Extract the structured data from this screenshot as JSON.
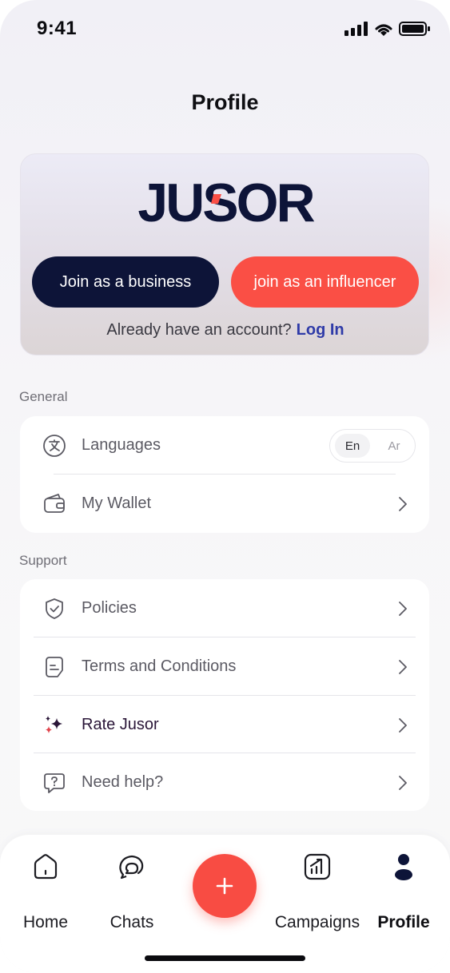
{
  "status_bar": {
    "time": "9:41"
  },
  "page": {
    "title": "Profile"
  },
  "hero": {
    "logo_text": "JUSOR",
    "business_button": "Join as a business",
    "influencer_button": "join as an influencer",
    "account_prompt": "Already have an account?",
    "login_link": "Log In"
  },
  "general": {
    "label": "General",
    "items": [
      {
        "label": "Languages",
        "icon": "translate-icon"
      },
      {
        "label": "My Wallet",
        "icon": "wallet-icon"
      }
    ],
    "language_options": [
      "En",
      "Ar"
    ],
    "selected_language": "En"
  },
  "support": {
    "label": "Support",
    "items": [
      {
        "label": "Policies",
        "icon": "shield-check-icon"
      },
      {
        "label": "Terms and Conditions",
        "icon": "document-icon"
      },
      {
        "label": "Rate Jusor",
        "icon": "sparkles-icon"
      },
      {
        "label": "Need help?",
        "icon": "help-chat-icon"
      }
    ]
  },
  "tab_bar": {
    "tabs": [
      {
        "label": "Home",
        "icon": "home-icon"
      },
      {
        "label": "Chats",
        "icon": "chat-bubbles-icon"
      },
      {
        "label": "Campaigns",
        "icon": "chart-growth-icon"
      },
      {
        "label": "Profile",
        "icon": "user-icon",
        "active": true
      }
    ],
    "fab_icon": "plus-icon"
  },
  "colors": {
    "navy": "#0d1438",
    "coral": "#fa4f45",
    "link": "#2f3ba8"
  }
}
